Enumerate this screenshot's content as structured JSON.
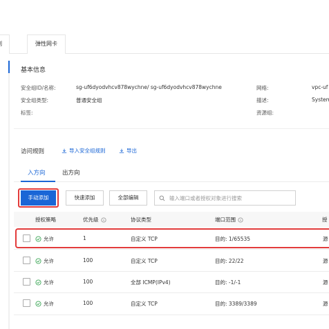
{
  "tabs": [
    "例",
    "弹性网卡"
  ],
  "basic_info": {
    "title": "基本信息",
    "fields": [
      {
        "label": "安全组ID/名称:",
        "value": "sg-uf6dyodvhcv878wychne/ sg-uf6dyodvhcv878wychne"
      },
      {
        "label": "安全组类型:",
        "value": "普通安全组"
      },
      {
        "label": "标签:",
        "value": ""
      }
    ],
    "right_fields": [
      {
        "label": "网络:",
        "value": "vpc-uf"
      },
      {
        "label": "描述:",
        "value": "System"
      },
      {
        "label": "资源组:",
        "value": ""
      }
    ]
  },
  "rules": {
    "title": "访问规则",
    "import_label": "导入安全组规则",
    "export_label": "导出",
    "direction_tabs": [
      "入方向",
      "出方向"
    ],
    "active_tab": "入方向",
    "buttons": {
      "manual_add": "手动添加",
      "quick_add": "快速添加",
      "edit_all": "全部编辑"
    },
    "search_placeholder": "输入端口或者授权对象进行搜索",
    "columns": [
      "授权策略",
      "优先级",
      "协议类型",
      "端口范围",
      "授"
    ],
    "rows": [
      {
        "policy": "允许",
        "priority": "1",
        "protocol": "自定义 TCP",
        "port": "目的: 1/65535",
        "auth": "源"
      },
      {
        "policy": "允许",
        "priority": "100",
        "protocol": "自定义 TCP",
        "port": "目的: 22/22",
        "auth": "源"
      },
      {
        "policy": "允许",
        "priority": "100",
        "protocol": "全部 ICMP(IPv4)",
        "port": "目的: -1/-1",
        "auth": "源"
      },
      {
        "policy": "允许",
        "priority": "100",
        "protocol": "自定义 TCP",
        "port": "目的: 3389/3389",
        "auth": "源"
      }
    ]
  },
  "colors": {
    "primary": "#1a66d6",
    "highlight": "#e23b3b",
    "allow_green": "#3aa655"
  }
}
